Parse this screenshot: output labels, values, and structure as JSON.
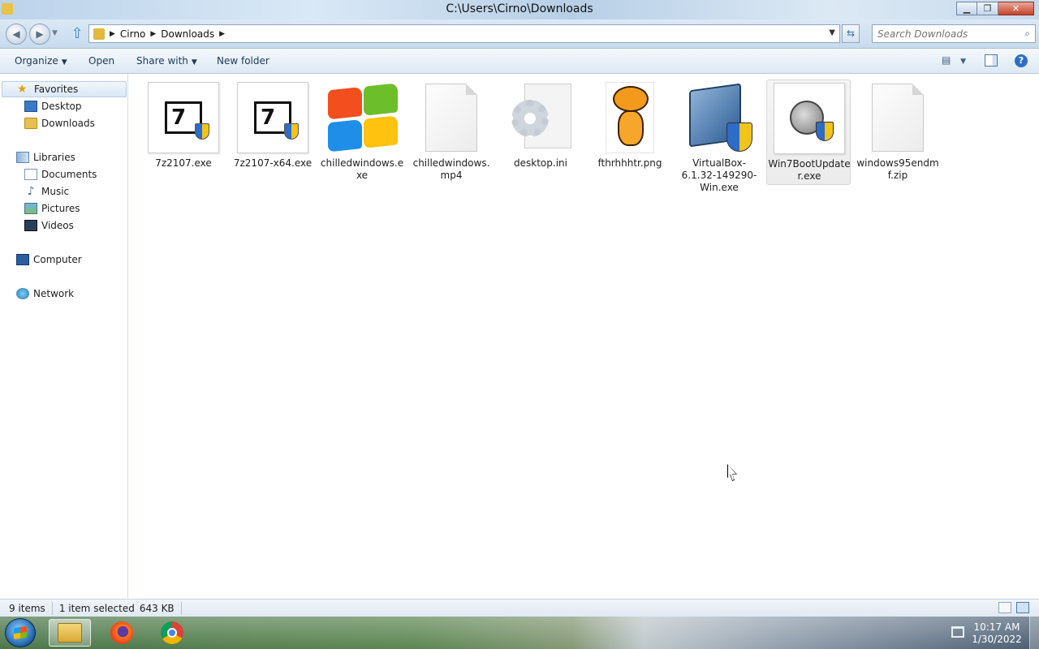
{
  "window": {
    "title": "C:\\Users\\Cirno\\Downloads",
    "minimize_glyph": "▁",
    "maximize_glyph": "❐",
    "close_glyph": "✕"
  },
  "address": {
    "breadcrumb": [
      "Cirno",
      "Downloads"
    ],
    "search_placeholder": "Search Downloads"
  },
  "toolbar": {
    "organize": "Organize",
    "open": "Open",
    "share_with": "Share with",
    "new_folder": "New folder",
    "help": "?"
  },
  "nav": {
    "favorites": "Favorites",
    "desktop": "Desktop",
    "downloads": "Downloads",
    "libraries": "Libraries",
    "documents": "Documents",
    "music": "Music",
    "pictures": "Pictures",
    "videos": "Videos",
    "computer": "Computer",
    "network": "Network"
  },
  "files": [
    {
      "name": "7z2107.exe",
      "icon": "7zip-installer-icon"
    },
    {
      "name": "7z2107-x64.exe",
      "icon": "7zip-installer-icon"
    },
    {
      "name": "chilledwindows.exe",
      "icon": "windows-logo-icon"
    },
    {
      "name": "chilledwindows.mp4",
      "icon": "blank-document-icon"
    },
    {
      "name": "desktop.ini",
      "icon": "settings-file-icon"
    },
    {
      "name": "fthrhhhtr.png",
      "icon": "garfield-image-thumbnail"
    },
    {
      "name": "VirtualBox-6.1.32-149290-Win.exe",
      "icon": "virtualbox-installer-icon"
    },
    {
      "name": "Win7BootUpdater.exe",
      "icon": "boot-updater-icon"
    },
    {
      "name": "windows95endmf.zip",
      "icon": "blank-document-icon"
    }
  ],
  "status": {
    "items_count": "9 items",
    "selected": "1 item selected",
    "size": "643 KB"
  },
  "clock": {
    "time": "10:17 AM",
    "date": "1/30/2022"
  }
}
